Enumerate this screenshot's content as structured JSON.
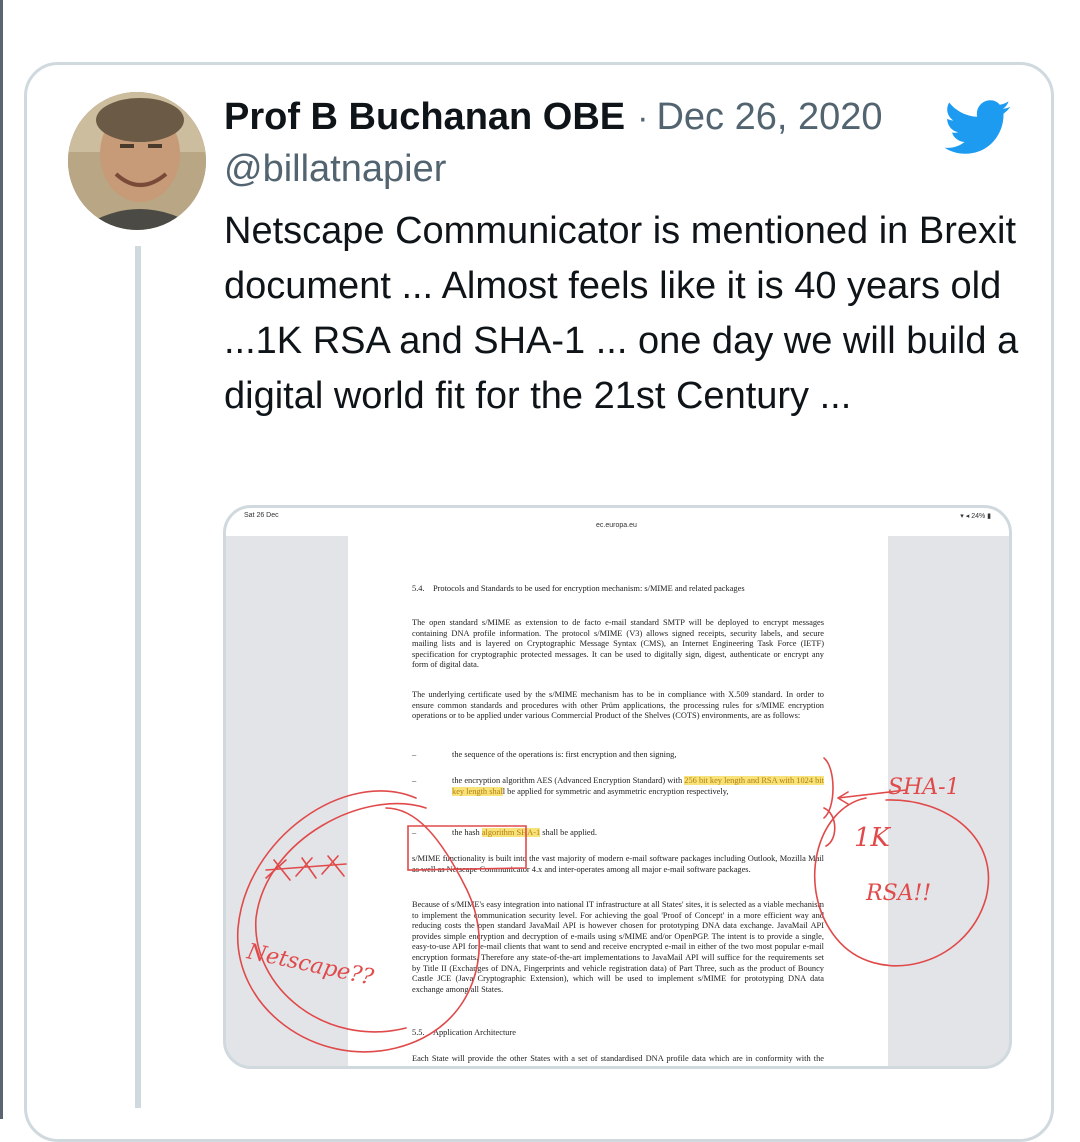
{
  "tweet": {
    "display_name": "Prof B Buchanan OBE",
    "separator": "·",
    "date": "Dec 26, 2020",
    "handle": "@billatnapier",
    "text": "Netscape Communicator is mentioned in Brexit document ... Almost feels like it is 40 years old ...1K RSA and SHA-1 ... one day we will build a digital world fit for the 21st Century ..."
  },
  "colors": {
    "twitter_blue": "#1d9bf0",
    "secondary_text": "#536471",
    "card_border": "#cfd9de",
    "annotation_red": "#e04a4a",
    "highlight": "#f8e37a"
  },
  "media": {
    "status_bar": {
      "time": "Sat 26 Dec",
      "url": "ec.europa.eu",
      "battery": "24%"
    },
    "document": {
      "heading": "5.4. Protocols and Standards to be used for encryption mechanism: s/MIME and related packages",
      "p1": "The open standard s/MIME as extension to de facto e-mail standard SMTP will be deployed to encrypt messages containing DNA profile information. The protocol s/MIME (V3) allows signed receipts, security labels, and secure mailing lists and is layered on Cryptographic Message Syntax (CMS), an Internet Engineering Task Force (IETF) specification for cryptographic protected messages. It can be used to digitally sign, digest, authenticate or encrypt any form of digital data.",
      "p2": "The underlying certificate used by the s/MIME mechanism has to be in compliance with X.509 standard. In order to ensure common standards and procedures with other Prüm applications, the processing rules for s/MIME encryption operations or to be applied under various Commercial Product of the Shelves (COTS) environments, are as follows:",
      "dash": "–",
      "b1": "the sequence of the operations is: first encryption and then signing,",
      "b2_pre": "the encryption algorithm AES (Advanced Encryption Standard) with ",
      "b2_hl1": "256 bit key length and RSA with 1024 bit key length shal",
      "b2_post": "l be applied for symmetric and asymmetric encryption respectively,",
      "b3_pre": "the hash ",
      "b3_hl": "algorithm SHA-1",
      "b3_post": " shall be applied.",
      "p3": "s/MIME functionality is built into the vast majority of modern e-mail software packages including Outlook, Mozilla Mail as well as Netscape Communicator 4.x and inter-operates among all major e-mail software packages.",
      "p4": "Because of s/MIME's easy integration into national IT infrastructure at all States' sites, it is selected as a viable mechanism to implement the communication security level. For achieving the goal 'Proof of Concept' in a more efficient way and reducing costs the open standard JavaMail API is however chosen for prototyping DNA data exchange. JavaMail API provides simple encryption and decryption of e-mails using s/MIME and/or OpenPGP. The intent is to provide a single, easy-to-use API for e-mail clients that want to send and receive encrypted e-mail in either of the two most popular e-mail encryption formats. Therefore any state-of-the-art implementations to JavaMail API will suffice for the requirements set by Title II (Exchanges of DNA, Fingerprints and vehicle registration data) of Part Three, such as the product of Bouncy Castle JCE (Java Cryptographic Extension), which will be used to implement s/MIME for prototyping DNA data exchange among all States.",
      "heading2": "5.5. Application Architecture",
      "p5": "Each State will provide the other States with a set of standardised DNA profile data which are in conformity with the current common ICD. This can be done either by providing a logical view over individual national database or by establishing a physical exported database (indexed database)."
    },
    "annotations": {
      "left_note": "Netscape??",
      "right_note_1": "SHA-1",
      "right_note_2": "1K",
      "right_note_3": "RSA!!"
    }
  }
}
